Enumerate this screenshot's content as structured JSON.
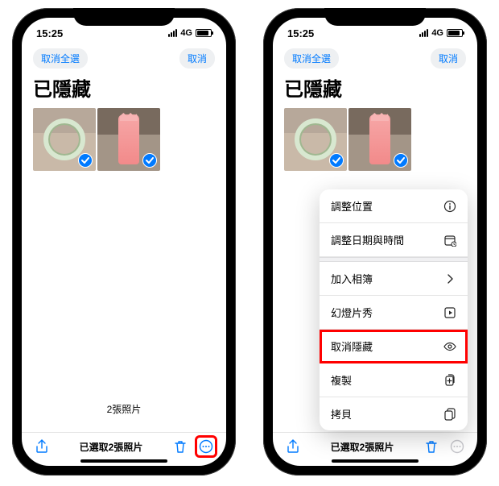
{
  "status": {
    "time": "15:25",
    "network": "4G"
  },
  "nav": {
    "deselect_all": "取消全選",
    "cancel": "取消"
  },
  "title": "已隱藏",
  "photo_count": "2張照片",
  "selected": "已選取2張照片",
  "menu": {
    "adjust_location": "調整位置",
    "adjust_datetime": "調整日期與時間",
    "add_to_album": "加入相簿",
    "slideshow": "幻燈片秀",
    "unhide": "取消隱藏",
    "duplicate": "複製",
    "copy": "拷貝"
  },
  "icons": {
    "share": "share-icon",
    "trash": "trash-icon",
    "more": "more-icon",
    "info": "info-icon",
    "calendar": "calendar-icon",
    "chevron": "chevron-right-icon",
    "play": "play-square-icon",
    "eye": "eye-icon",
    "duplicate": "plus-square-icon",
    "copy": "copy-icon"
  }
}
